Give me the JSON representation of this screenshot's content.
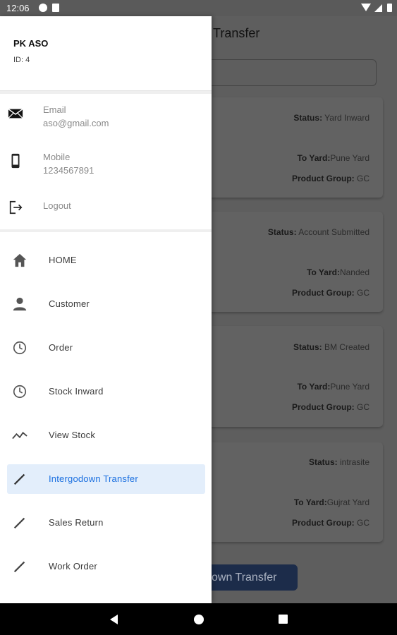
{
  "status_bar": {
    "time": "12:06"
  },
  "background": {
    "title": "Transfer",
    "cards": [
      {
        "status_label": "Status:",
        "status": " Yard Inward",
        "to_yard_label": "To Yard:",
        "to_yard": "Pune Yard",
        "group_label": "Product Group:",
        "group": " GC"
      },
      {
        "status_label": "Status:",
        "status": " Account Submitted",
        "to_yard_label": "To Yard:",
        "to_yard": "Nanded",
        "group_label": "Product Group:",
        "group": " GC"
      },
      {
        "status_label": "Status:",
        "status": " BM Created",
        "to_yard_label": "To Yard:",
        "to_yard": "Pune Yard",
        "group_label": "Product Group:",
        "group": " GC"
      },
      {
        "status_label": "Status:",
        "status": " intrasite",
        "to_yard_label": "To Yard:",
        "to_yard": "Gujrat Yard",
        "group_label": "Product Group:",
        "group": " GC"
      }
    ],
    "button_label": "own Transfer"
  },
  "drawer": {
    "user_name": "PK ASO",
    "user_id": "ID: 4",
    "email": {
      "label": "Email",
      "value": "aso@gmail.com",
      "icon": "email-icon"
    },
    "mobile": {
      "label": "Mobile",
      "value": "1234567891",
      "icon": "phone-icon"
    },
    "logout": {
      "label": "Logout",
      "icon": "logout-icon"
    },
    "menu": [
      {
        "label": "HOME",
        "icon": "home-icon"
      },
      {
        "label": "Customer",
        "icon": "person-icon"
      },
      {
        "label": "Order",
        "icon": "clock-icon"
      },
      {
        "label": "Stock Inward",
        "icon": "clock-icon"
      },
      {
        "label": "View Stock",
        "icon": "trend-icon"
      },
      {
        "label": "Intergodown Transfer",
        "icon": "pencil-icon",
        "active": true
      },
      {
        "label": "Sales Return",
        "icon": "pencil-icon"
      },
      {
        "label": "Work Order",
        "icon": "pencil-icon"
      }
    ]
  },
  "colors": {
    "active_bg": "#e3eefb",
    "active_text": "#1a6fe0",
    "scrim": "#5e5e5e"
  }
}
